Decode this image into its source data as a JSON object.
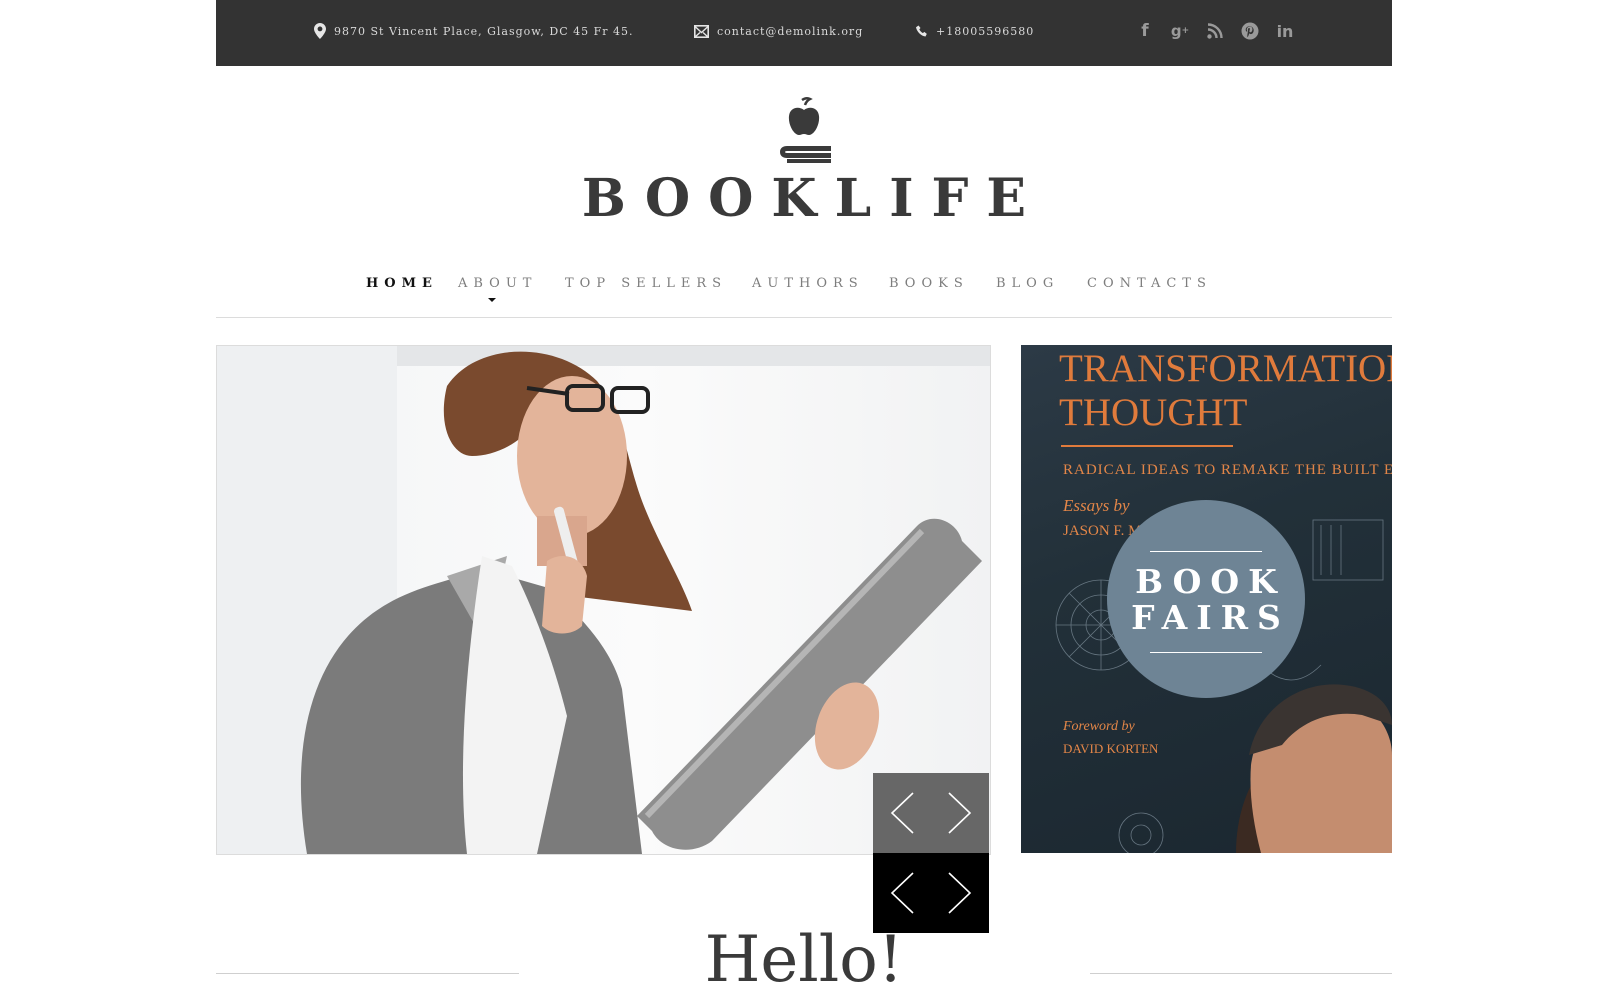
{
  "topbar": {
    "address": "9870 St Vincent Place, Glasgow, DC 45 Fr 45.",
    "email": "contact@demolink.org",
    "phone": "+18005596580",
    "social": [
      "facebook-icon",
      "google-plus-icon",
      "rss-icon",
      "pinterest-icon",
      "linkedin-icon"
    ]
  },
  "logo": {
    "text": "BOOKLIFE",
    "icon": "apple-on-book-icon"
  },
  "nav": {
    "items": [
      {
        "label": "HOME"
      },
      {
        "label": "ABOUT"
      },
      {
        "label": "TOP SELLERS"
      },
      {
        "label": "AUTHORS"
      },
      {
        "label": "BOOKS"
      },
      {
        "label": "BLOG"
      },
      {
        "label": "CONTACTS"
      }
    ],
    "active": "HOME"
  },
  "banner": {
    "title_line1": "TRANSFORMATIONAL",
    "title_line2": "THOUGHT",
    "subtitle": "RADICAL IDEAS TO REMAKE THE BUILT ENVIRONMENT",
    "essays_by": "Essays by",
    "author": "JASON F. McLENNAN",
    "foreword_by": "Foreword by",
    "foreword_author": "DAVID KORTEN",
    "circle_line1": "BOOK",
    "circle_line2": "FAIRS"
  },
  "section": {
    "heading": "Hello!"
  },
  "colors": {
    "topbar": "#333333",
    "accent_orange": "#e07b3c",
    "circle": "#6e8495"
  }
}
